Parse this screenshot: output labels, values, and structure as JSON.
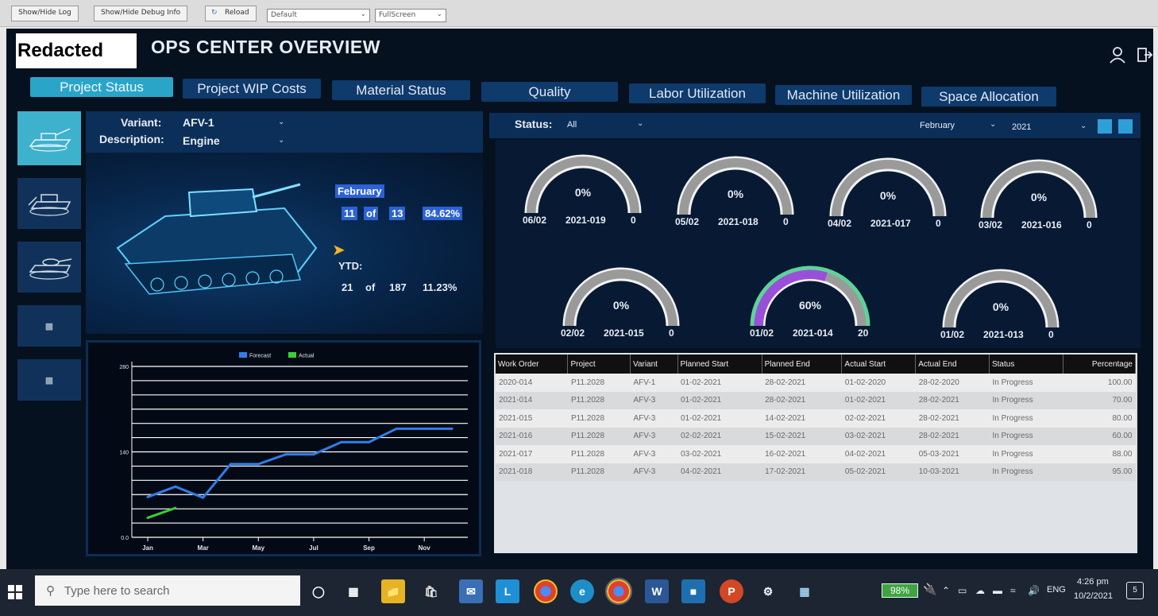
{
  "browser": {
    "show_hide_log": "Show/Hide Log",
    "show_hide_debug": "Show/Hide Debug Info",
    "reload": "Reload",
    "mode_select": "Default",
    "view_select": "FullScreen"
  },
  "header": {
    "logo_text": "Redacted",
    "title": "OPS CENTER OVERVIEW",
    "user_icon": "user-icon",
    "logout_icon": "logout-icon"
  },
  "tabs": [
    {
      "label": "Project Status",
      "active": true
    },
    {
      "label": "Project WIP Costs",
      "active": false
    },
    {
      "label": "Material Status",
      "active": false
    },
    {
      "label": "Quality",
      "active": false
    },
    {
      "label": "Labor Utilization",
      "active": false
    },
    {
      "label": "Machine Utilization",
      "active": false
    },
    {
      "label": "Space Allocation",
      "active": false
    }
  ],
  "variant_panel": {
    "variant_label": "Variant:",
    "variant_value": "AFV-1",
    "description_label": "Description:",
    "description_value": "Engine"
  },
  "month_stats": {
    "month": "February",
    "done": "11",
    "of": "of",
    "total": "13",
    "percent": "84.62%"
  },
  "ytd_stats": {
    "label": "YTD:",
    "done": "21",
    "of": "of",
    "total": "187",
    "percent": "11.23%"
  },
  "chart_data": {
    "type": "line",
    "legend": [
      "Forecast",
      "Actual"
    ],
    "x_ticks": [
      "Jan",
      "Mar",
      "May",
      "Jul",
      "Sep",
      "Nov"
    ],
    "y_ticks": [
      "280",
      "140",
      "0.0"
    ],
    "ylim": [
      0,
      280
    ],
    "series": [
      {
        "name": "Forecast",
        "color": "#2f7fe8",
        "x": [
          1,
          2,
          3,
          4,
          5,
          6,
          7,
          8,
          9,
          10,
          11,
          12
        ],
        "values": [
          66,
          83,
          65,
          120,
          120,
          136,
          136,
          156,
          156,
          178,
          178,
          178
        ]
      },
      {
        "name": "Actual",
        "color": "#35d135",
        "x": [
          1,
          2
        ],
        "values": [
          32,
          48
        ]
      }
    ]
  },
  "filters": {
    "status_label": "Status:",
    "status_value": "All",
    "month_value": "February",
    "year_value": "2021"
  },
  "gauges": [
    {
      "percent_label": "0%",
      "value": 0,
      "date": "06/02",
      "order": "2021-019",
      "count": "0"
    },
    {
      "percent_label": "0%",
      "value": 0,
      "date": "05/02",
      "order": "2021-018",
      "count": "0"
    },
    {
      "percent_label": "0%",
      "value": 0,
      "date": "04/02",
      "order": "2021-017",
      "count": "0"
    },
    {
      "percent_label": "0%",
      "value": 0,
      "date": "03/02",
      "order": "2021-016",
      "count": "0"
    },
    {
      "percent_label": "0%",
      "value": 0,
      "date": "02/02",
      "order": "2021-015",
      "count": "0"
    },
    {
      "percent_label": "60%",
      "value": 60,
      "date": "01/02",
      "order": "2021-014",
      "count": "20"
    },
    {
      "percent_label": "0%",
      "value": 0,
      "date": "01/02",
      "order": "2021-013",
      "count": "0"
    }
  ],
  "table": {
    "headers": [
      "Work Order",
      "Project",
      "Variant",
      "Planned Start",
      "Planned End",
      "Actual Start",
      "Actual End",
      "Status",
      "Percentage"
    ],
    "rows": [
      [
        "2020-014",
        "P11.2028",
        "AFV-1",
        "01-02-2021",
        "28-02-2021",
        "01-02-2020",
        "28-02-2020",
        "In Progress",
        "100.00"
      ],
      [
        "2021-014",
        "P11.2028",
        "AFV-3",
        "01-02-2021",
        "28-02-2021",
        "01-02-2021",
        "28-02-2021",
        "In Progress",
        "70.00"
      ],
      [
        "2021-015",
        "P11.2028",
        "AFV-3",
        "01-02-2021",
        "14-02-2021",
        "02-02-2021",
        "28-02-2021",
        "In Progress",
        "80.00"
      ],
      [
        "2021-016",
        "P11.2028",
        "AFV-3",
        "02-02-2021",
        "15-02-2021",
        "03-02-2021",
        "28-02-2021",
        "In Progress",
        "60.00"
      ],
      [
        "2021-017",
        "P11.2028",
        "AFV-3",
        "03-02-2021",
        "16-02-2021",
        "04-02-2021",
        "05-03-2021",
        "In Progress",
        "88.00"
      ],
      [
        "2021-018",
        "P11.2028",
        "AFV-3",
        "04-02-2021",
        "17-02-2021",
        "05-02-2021",
        "10-03-2021",
        "In Progress",
        "95.00"
      ]
    ]
  },
  "taskbar": {
    "search_placeholder": "Type here to search",
    "battery": "98%",
    "language": "ENG",
    "time": "4:26 pm",
    "date": "10/2/2021",
    "notification_count": "5"
  }
}
